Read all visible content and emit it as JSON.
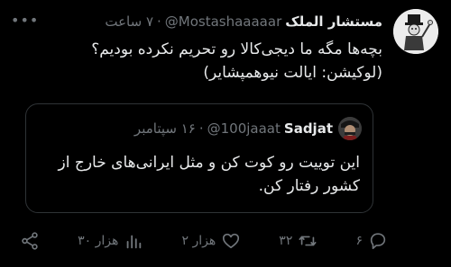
{
  "tweet": {
    "author_name": "مستشار الملک",
    "author_handle": "@Mostashaaaaar",
    "separator": "·",
    "time": "۷ ساعت",
    "text_lines": [
      "بچه‌ها مگه ما دیجی‌کالا رو تحریم نکرده بودیم؟",
      "(لوکیشن: ایالت نیوهمپشایر)"
    ],
    "more": "•••"
  },
  "quoted": {
    "author_name": "Sadjat",
    "author_handle": "@100jaaat",
    "separator": "·",
    "time": "۱۶ سپتامبر",
    "text_lines": [
      "این توییت رو کوت کن و مثل ایرانی‌های خارج از",
      "کشور رفتار کن."
    ]
  },
  "actions": {
    "reply_count": "۶",
    "retweet_count": "۳۲",
    "like_count": "۲ هزار",
    "views_count": "۳۰ هزار"
  },
  "icons": {
    "reply": "reply-icon",
    "retweet": "retweet-icon",
    "like": "heart-icon",
    "views": "views-icon",
    "share": "share-icon",
    "more": "more-icon"
  },
  "colors": {
    "background": "#000000",
    "text": "#e7e9ea",
    "muted": "#71767b",
    "border": "#2f3336"
  }
}
